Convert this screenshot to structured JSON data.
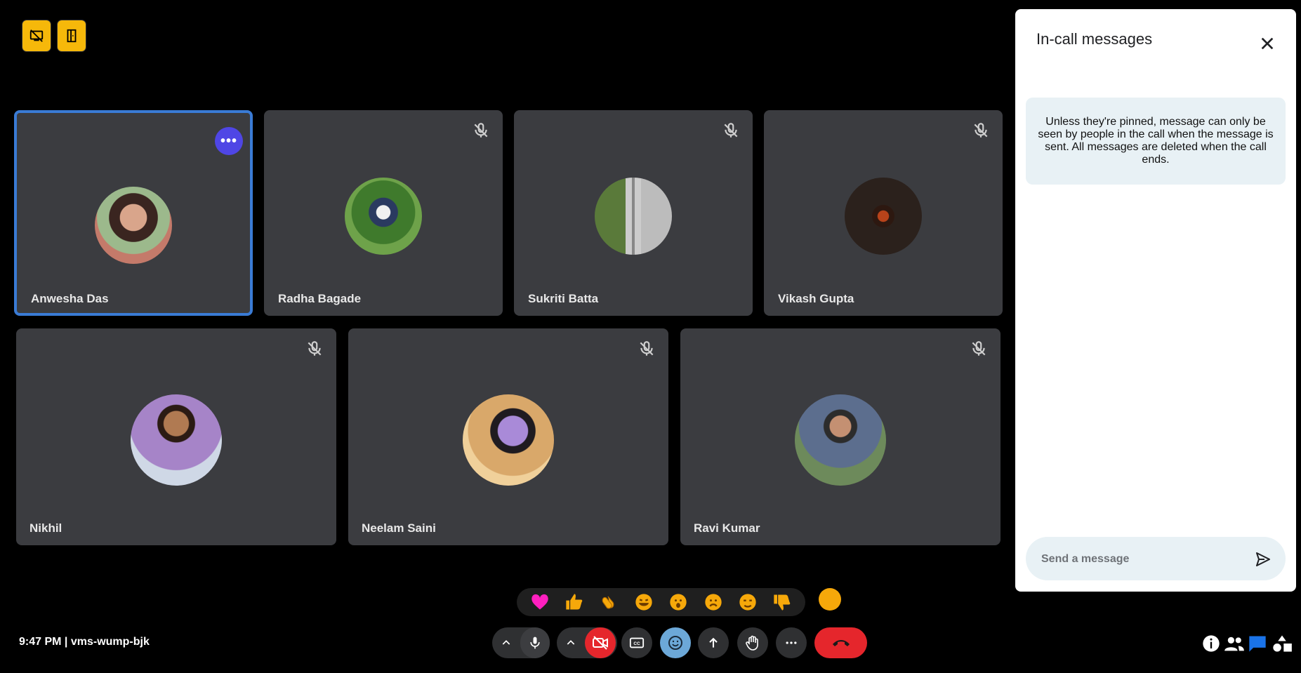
{
  "top_buttons": [
    {
      "label": "",
      "icon": "screen-off-icon"
    },
    {
      "label": "",
      "icon": "door-exit-icon"
    }
  ],
  "participants": [
    {
      "name": "Anwesha Das",
      "active": true,
      "muted": false,
      "avatar": "user-photo"
    },
    {
      "name": "Radha Bagade",
      "active": false,
      "muted": true,
      "avatar": "user-photo"
    },
    {
      "name": "Sukriti Batta",
      "active": false,
      "muted": true,
      "avatar": "user-photo"
    },
    {
      "name": "Vikash Gupta",
      "active": false,
      "muted": true,
      "avatar": "user-photo"
    },
    {
      "name": "Nikhil",
      "active": false,
      "muted": true,
      "avatar": "user-photo"
    },
    {
      "name": "Neelam Saini",
      "active": false,
      "muted": true,
      "avatar": "user-photo"
    },
    {
      "name": "Ravi Kumar",
      "active": false,
      "muted": true,
      "avatar": "user-photo"
    }
  ],
  "chat_panel": {
    "title": "In-call messages",
    "notice": "Unless they're pinned, message can only be seen by people in the call when the message is sent. All messages are deleted when the call ends.",
    "input_placeholder": "Send a message"
  },
  "reactions": [
    "heart-icon",
    "thumbs-up-icon",
    "clapping-hands-icon",
    "laughing-face-icon",
    "surprised-face-icon",
    "sad-face-icon",
    "thinking-face-icon",
    "thumbs-down-icon"
  ],
  "meeting": {
    "info": "9:47 PM | vms-wump-bjk"
  },
  "controls": {
    "mic_options": "chevron-up-icon",
    "mic": "mic-icon",
    "camera_options": "chevron-up-icon",
    "camera": "camera-off-icon",
    "captions": "closed-captions-icon",
    "emoji": "emoji-icon",
    "present": "present-icon",
    "raise_hand": "raise-hand-icon",
    "more": "more-options-icon",
    "end_call": "end-call-icon"
  },
  "right_toolbar": [
    "info-icon",
    "people-icon",
    "chat-icon",
    "activities-icon"
  ],
  "colors": {
    "accent_yellow": "#f6b80a",
    "tile_bg": "#3b3c40",
    "active_border": "#3a7bd5",
    "end_call_red": "#e5262c",
    "chat_highlight": "#1a73e8"
  }
}
